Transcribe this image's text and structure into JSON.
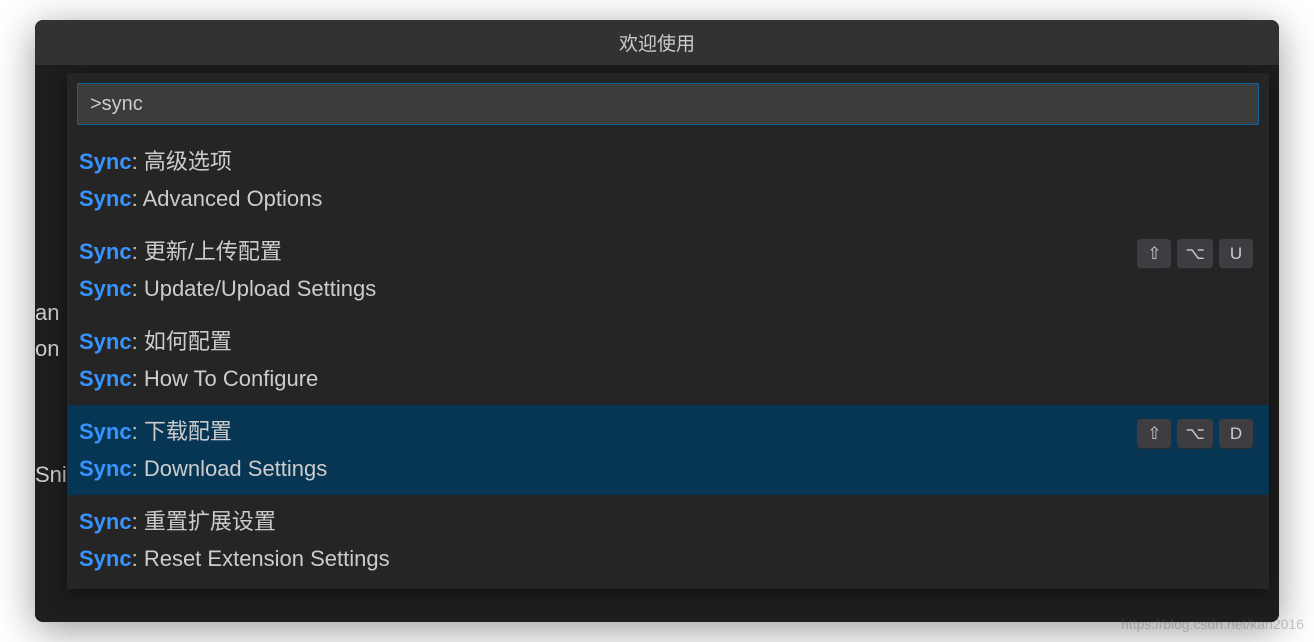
{
  "window": {
    "title": "欢迎使用"
  },
  "background": {
    "frag1": "an",
    "frag2": "on",
    "frag3": "Snip"
  },
  "palette": {
    "query": ">sync",
    "items": [
      {
        "prefix": "Sync",
        "title_cn": ": 高级选项",
        "title_en": ": Advanced Options",
        "keys": [],
        "selected": false
      },
      {
        "prefix": "Sync",
        "title_cn": ": 更新/上传配置",
        "title_en": ": Update/Upload Settings",
        "keys": [
          "⇧",
          "⌥",
          "U"
        ],
        "selected": false
      },
      {
        "prefix": "Sync",
        "title_cn": ": 如何配置",
        "title_en": ": How To Configure",
        "keys": [],
        "selected": false
      },
      {
        "prefix": "Sync",
        "title_cn": ": 下载配置",
        "title_en": ": Download Settings",
        "keys": [
          "⇧",
          "⌥",
          "D"
        ],
        "selected": true
      },
      {
        "prefix": "Sync",
        "title_cn": ": 重置扩展设置",
        "title_en": ": Reset Extension Settings",
        "keys": [],
        "selected": false
      }
    ]
  },
  "watermark": "https://blog.csdn.net/kan2016"
}
